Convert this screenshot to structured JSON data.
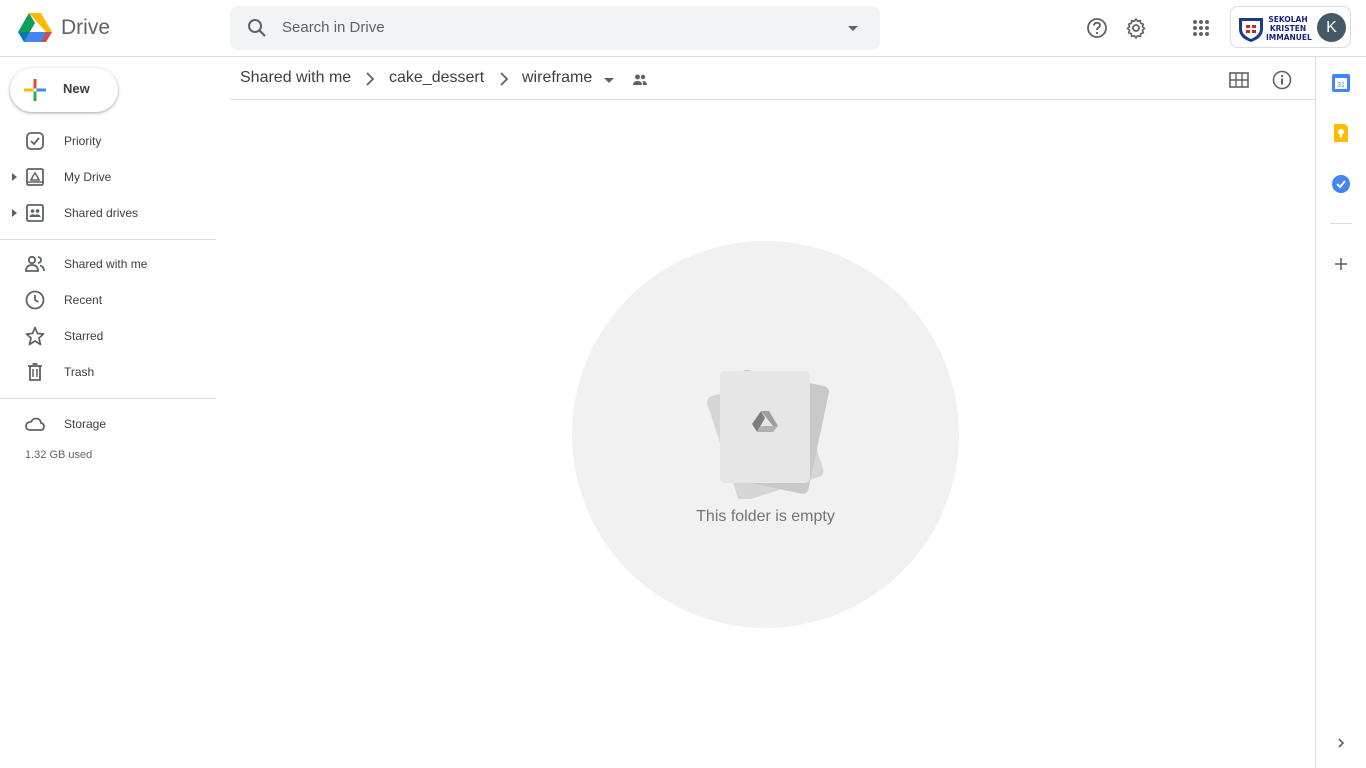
{
  "app": {
    "name": "Drive"
  },
  "search": {
    "placeholder": "Search in Drive"
  },
  "account": {
    "org_line1": "SEKOLAH",
    "org_line2": "KRISTEN",
    "org_line3": "IMMANUEL",
    "avatar_letter": "K"
  },
  "sidebar": {
    "new_label": "New",
    "items": [
      {
        "label": "Priority",
        "icon": "priority-icon"
      },
      {
        "label": "My Drive",
        "icon": "my-drive-icon",
        "expandable": true
      },
      {
        "label": "Shared drives",
        "icon": "shared-drives-icon",
        "expandable": true
      },
      {
        "label": "Shared with me",
        "icon": "shared-with-me-icon"
      },
      {
        "label": "Recent",
        "icon": "clock-icon"
      },
      {
        "label": "Starred",
        "icon": "star-icon"
      },
      {
        "label": "Trash",
        "icon": "trash-icon"
      },
      {
        "label": "Storage",
        "icon": "cloud-icon"
      }
    ],
    "storage_used": "1.32 GB used"
  },
  "breadcrumb": {
    "items": [
      "Shared with me",
      "cake_dessert",
      "wireframe"
    ]
  },
  "empty_state": {
    "message": "This folder is empty"
  },
  "colors": {
    "accent_blue": "#1a73e8",
    "divider": "#dadce0",
    "search_bg": "#f1f3f4"
  }
}
